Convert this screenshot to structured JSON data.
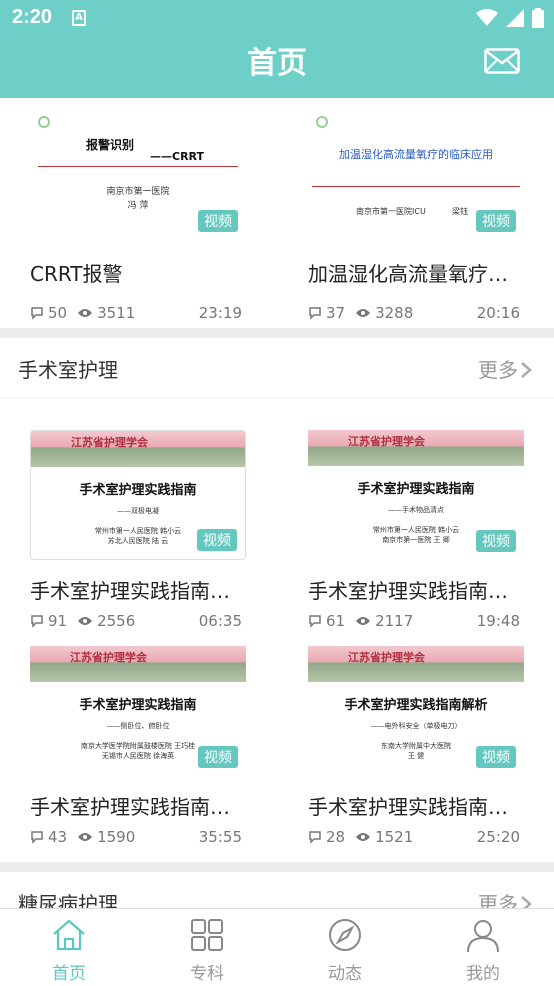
{
  "status": {
    "time": "2:20",
    "app_icon": "A"
  },
  "header": {
    "title": "首页"
  },
  "colors": {
    "accent": "#6ecfc8",
    "tag": "#64c8c0",
    "active_tab": "#5cc7c0"
  },
  "top_cards": [
    {
      "title": "CRRT报警",
      "comments": "50",
      "views": "3511",
      "time": "23:19",
      "tag": "视频",
      "slide": {
        "title": "报警识别",
        "subtitle": "——CRRT",
        "org": "南京市第一医院",
        "author": "冯 萍"
      }
    },
    {
      "title": "加温湿化高流量氧疗…",
      "comments": "37",
      "views": "3288",
      "time": "20:16",
      "tag": "视频",
      "slide": {
        "title": "加温湿化高流量氧疗的临床应用",
        "org": "南京市第一医院ICU",
        "author": "梁钰"
      }
    }
  ],
  "section1": {
    "title": "手术室护理",
    "more": "更多",
    "cards": [
      {
        "title": "手术室护理实践指南…",
        "comments": "91",
        "views": "2556",
        "time": "06:35",
        "tag": "视频",
        "slide": {
          "logo": "江苏省护理学会",
          "title": "手术室护理实践指南",
          "subtitle": "——双极电凝",
          "line1": "常州市第一人民医院  韩小云",
          "line2": "苏北人民医院        陆 云"
        }
      },
      {
        "title": "手术室护理实践指南…",
        "comments": "61",
        "views": "2117",
        "time": "19:48",
        "tag": "视频",
        "slide": {
          "logo": "江苏省护理学会",
          "title": "手术室护理实践指南",
          "subtitle": "——手术物品清点",
          "line1": "常州市第一人民医院  韩小云",
          "line2": "南京市第一医院    王 卿"
        }
      },
      {
        "title": "手术室护理实践指南…",
        "comments": "43",
        "views": "1590",
        "time": "35:55",
        "tag": "视频",
        "slide": {
          "logo": "江苏省护理学会",
          "title": "手术室护理实践指南",
          "subtitle": "——侧卧位、俯卧位",
          "line1": "南京大学医学院附属鼓楼医院  王巧桂",
          "line2": "无锡市人民医院          徐海英"
        }
      },
      {
        "title": "手术室护理实践指南…",
        "comments": "28",
        "views": "1521",
        "time": "25:20",
        "tag": "视频",
        "slide": {
          "logo": "江苏省护理学会",
          "title": "手术室护理实践指南解析",
          "subtitle": "——电外科安全（单极电刀）",
          "line1": "东南大学附属中大医院",
          "line2": "王 健"
        }
      }
    ]
  },
  "section2": {
    "title": "糖尿病护理",
    "more": "更多"
  },
  "tabs": [
    {
      "label": "首页",
      "icon": "home-icon"
    },
    {
      "label": "专科",
      "icon": "grid-icon"
    },
    {
      "label": "动态",
      "icon": "compass-icon"
    },
    {
      "label": "我的",
      "icon": "user-icon"
    }
  ]
}
